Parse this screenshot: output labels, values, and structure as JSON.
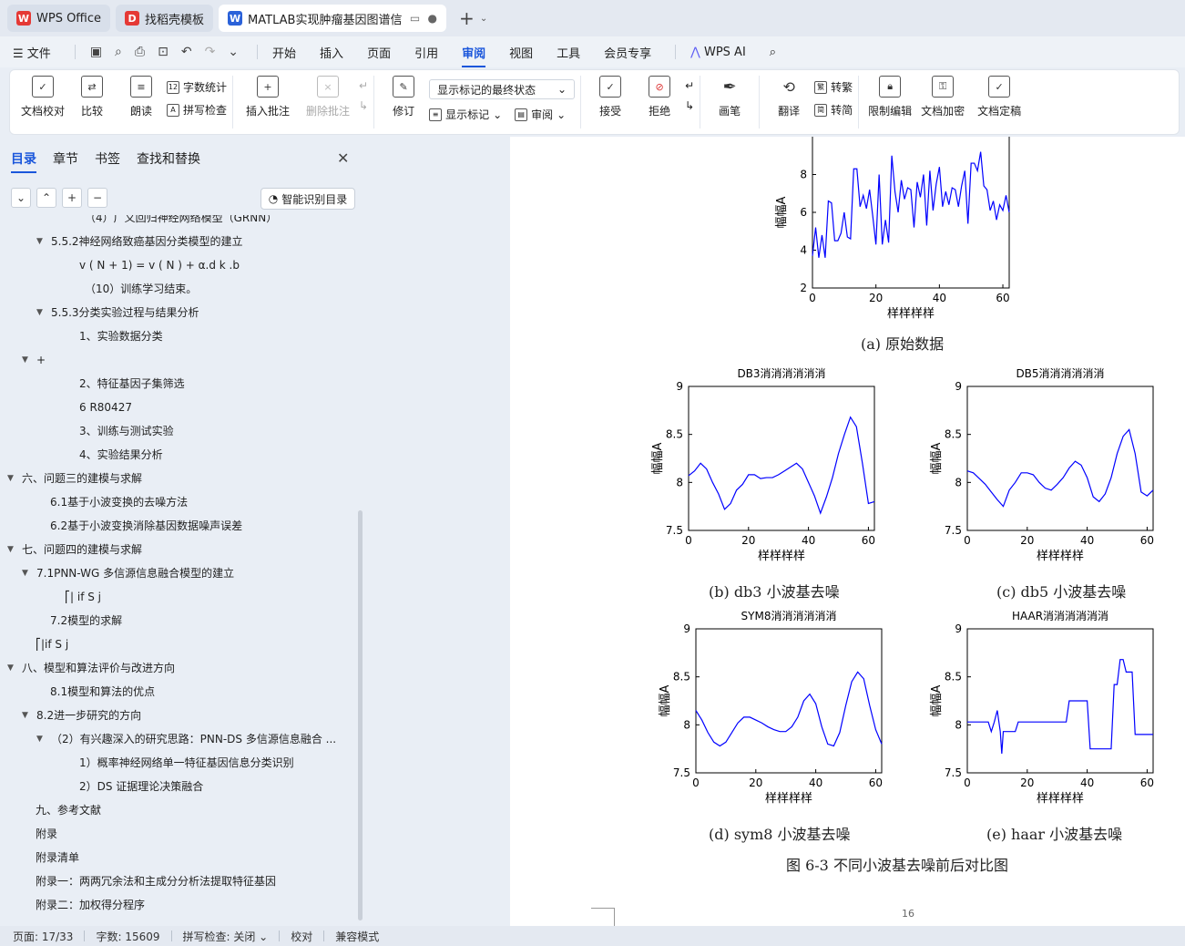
{
  "tabs": [
    {
      "label": "WPS Office",
      "icon": "wps-logo-icon"
    },
    {
      "label": "找稻壳模板",
      "icon": "docer-icon"
    },
    {
      "label": "MATLAB实现肿瘤基因图谱信",
      "icon": "word-doc-icon",
      "active": true
    }
  ],
  "menubar": {
    "file": "文件",
    "items": [
      "开始",
      "插入",
      "页面",
      "引用",
      "审阅",
      "视图",
      "工具",
      "会员专享"
    ],
    "active": "审阅",
    "ai": "WPS AI"
  },
  "ribbon": {
    "doc_check": "文档校对",
    "compare": "比较",
    "read_aloud": "朗读",
    "word_count": "字数统计",
    "spell_check": "拼写检查",
    "insert_comment": "插入批注",
    "delete_comment": "删除批注",
    "track": "修订",
    "markup_select": "显示标记的最终状态",
    "show_markup": "显示标记",
    "review": "审阅",
    "accept": "接受",
    "reject": "拒绝",
    "pen": "画笔",
    "translate": "翻译",
    "to_traditional": "转繁",
    "to_simplified": "转简",
    "restrict": "限制编辑",
    "encrypt": "文档加密",
    "finalize": "文档定稿"
  },
  "nav": {
    "tabs": [
      "目录",
      "章节",
      "书签",
      "查找和替换"
    ],
    "active_tab": "目录",
    "smart_btn": "智能识别目录",
    "items": [
      {
        "text": "（4）广义回归神经网络模型（GRNN）",
        "indent": 93,
        "tri": ""
      },
      {
        "text": "5.5.2神经网络致癌基因分类模型的建立",
        "indent": 56,
        "tri": "▼"
      },
      {
        "text": "v ( N + 1) = v ( N ) + α.d k .b",
        "indent": 87,
        "tri": ""
      },
      {
        "text": "（10）训练学习结束。",
        "indent": 93,
        "tri": ""
      },
      {
        "text": "5.5.3分类实验过程与结果分析",
        "indent": 56,
        "tri": "▼"
      },
      {
        "text": "1、实验数据分类",
        "indent": 87,
        "tri": ""
      },
      {
        "text": "+",
        "indent": 40,
        "tri": "▼"
      },
      {
        "text": "2、特征基因子集筛选",
        "indent": 87,
        "tri": ""
      },
      {
        "text": "6 R80427",
        "indent": 87,
        "tri": ""
      },
      {
        "text": "3、训练与测试实验",
        "indent": 87,
        "tri": ""
      },
      {
        "text": "4、实验结果分析",
        "indent": 87,
        "tri": ""
      },
      {
        "text": "六、问题三的建模与求解",
        "indent": 24,
        "tri": "▼"
      },
      {
        "text": "6.1基于小波变换的去噪方法",
        "indent": 55,
        "tri": ""
      },
      {
        "text": "6.2基于小波变换消除基因数据噪声误差",
        "indent": 55,
        "tri": ""
      },
      {
        "text": "七、问题四的建模与求解",
        "indent": 24,
        "tri": "▼"
      },
      {
        "text": "7.1PNN-WG 多信源信息融合模型的建立",
        "indent": 40,
        "tri": "▼"
      },
      {
        "text": "⎡| if  S j",
        "indent": 71,
        "tri": ""
      },
      {
        "text": "7.2模型的求解",
        "indent": 55,
        "tri": ""
      },
      {
        "text": "⎡|if  S j",
        "indent": 39,
        "tri": ""
      },
      {
        "text": "八、模型和算法评价与改进方向",
        "indent": 24,
        "tri": "▼"
      },
      {
        "text": "8.1模型和算法的优点",
        "indent": 55,
        "tri": ""
      },
      {
        "text": "8.2进一步研究的方向",
        "indent": 40,
        "tri": "▼"
      },
      {
        "text": "（2）有兴趣深入的研究思路：PNN-DS 多信源信息融合 ...",
        "indent": 56,
        "tri": "▼"
      },
      {
        "text": "1）概率神经网络单一特征基因信息分类识别",
        "indent": 87,
        "tri": ""
      },
      {
        "text": "2）DS 证据理论决策融合",
        "indent": 87,
        "tri": ""
      },
      {
        "text": "九、参考文献",
        "indent": 39,
        "tri": ""
      },
      {
        "text": "附录",
        "indent": 39,
        "tri": ""
      },
      {
        "text": "附录清单",
        "indent": 39,
        "tri": ""
      },
      {
        "text": "附录一：两两冗余法和主成分分析法提取特征基因",
        "indent": 39,
        "tri": ""
      },
      {
        "text": "附录二：加权得分程序",
        "indent": 39,
        "tri": ""
      }
    ]
  },
  "document": {
    "captions": {
      "a": "(a) 原始数据",
      "b": "(b) db3  小波基去噪",
      "c": "(c) db5 小波基去噪",
      "d": "(d) sym8 小波基去噪",
      "e": "(e) haar 小波基去噪",
      "figure": "图 6-3  不同小波基去噪前后对比图"
    },
    "page_number": "16"
  },
  "chart_data": [
    {
      "type": "line",
      "title": "",
      "xlabel": "样样样样",
      "ylabel": "幅幅A",
      "xlim": [
        0,
        62
      ],
      "ylim": [
        2,
        10
      ],
      "xticks": [
        0,
        20,
        40,
        60
      ],
      "yticks": [
        2,
        4,
        6,
        8
      ],
      "x": [
        0,
        1,
        2,
        3,
        4,
        5,
        6,
        7,
        8,
        9,
        10,
        11,
        12,
        13,
        14,
        15,
        16,
        17,
        18,
        19,
        20,
        21,
        22,
        23,
        24,
        25,
        26,
        27,
        28,
        29,
        30,
        31,
        32,
        33,
        34,
        35,
        36,
        37,
        38,
        39,
        40,
        41,
        42,
        43,
        44,
        45,
        46,
        47,
        48,
        49,
        50,
        51,
        52,
        53,
        54,
        55,
        56,
        57,
        58,
        59,
        60,
        61,
        62
      ],
      "series": [
        {
          "values": [
            3.7,
            5.2,
            3.6,
            4.8,
            3.6,
            6.6,
            6.5,
            4.5,
            4.5,
            4.9,
            6.0,
            4.7,
            4.6,
            8.3,
            8.3,
            6.3,
            6.9,
            6.2,
            7.2,
            5.8,
            4.3,
            8.0,
            4.3,
            5.6,
            4.4,
            9.0,
            7.1,
            6.0,
            7.7,
            6.7,
            7.3,
            7.2,
            5.2,
            7.6,
            6.8,
            8.0,
            5.3,
            8.2,
            6.1,
            7.5,
            8.4,
            6.3,
            7.1,
            6.4,
            7.3,
            7.2,
            6.3,
            7.4,
            8.2,
            5.4,
            8.6,
            8.6,
            8.2,
            9.2,
            7.4,
            7.2,
            6.1,
            6.6,
            5.6,
            6.4,
            6.1,
            6.9,
            6.0
          ]
        }
      ]
    },
    {
      "type": "line",
      "title": "DB3消消消消消消",
      "xlabel": "样样样样",
      "ylabel": "幅幅A",
      "xlim": [
        0,
        62
      ],
      "ylim": [
        7.5,
        9
      ],
      "xticks": [
        0,
        20,
        40,
        60
      ],
      "yticks": [
        7.5,
        8,
        8.5,
        9
      ],
      "x": [
        0,
        2,
        4,
        6,
        8,
        10,
        12,
        14,
        16,
        18,
        20,
        22,
        24,
        26,
        28,
        30,
        32,
        34,
        36,
        38,
        40,
        42,
        44,
        46,
        48,
        50,
        52,
        54,
        56,
        58,
        60,
        62
      ],
      "series": [
        {
          "values": [
            8.07,
            8.12,
            8.2,
            8.14,
            8.0,
            7.88,
            7.72,
            7.78,
            7.92,
            7.98,
            8.08,
            8.08,
            8.04,
            8.05,
            8.05,
            8.08,
            8.12,
            8.16,
            8.2,
            8.14,
            8.0,
            7.86,
            7.68,
            7.85,
            8.05,
            8.3,
            8.5,
            8.68,
            8.58,
            8.2,
            7.78,
            7.8
          ]
        }
      ]
    },
    {
      "type": "line",
      "title": "DB5消消消消消消",
      "xlabel": "样样样样",
      "ylabel": "幅幅A",
      "xlim": [
        0,
        62
      ],
      "ylim": [
        7.5,
        9
      ],
      "xticks": [
        0,
        20,
        40,
        60
      ],
      "yticks": [
        7.5,
        8,
        8.5,
        9
      ],
      "x": [
        0,
        2,
        4,
        6,
        8,
        10,
        12,
        14,
        16,
        18,
        20,
        22,
        24,
        26,
        28,
        30,
        32,
        34,
        36,
        38,
        40,
        42,
        44,
        46,
        48,
        50,
        52,
        54,
        56,
        58,
        60,
        62
      ],
      "series": [
        {
          "values": [
            8.12,
            8.1,
            8.04,
            7.98,
            7.9,
            7.82,
            7.75,
            7.92,
            8.0,
            8.1,
            8.1,
            8.08,
            8.0,
            7.94,
            7.92,
            7.98,
            8.05,
            8.15,
            8.22,
            8.18,
            8.05,
            7.85,
            7.8,
            7.88,
            8.05,
            8.3,
            8.48,
            8.55,
            8.3,
            7.9,
            7.86,
            7.92
          ]
        }
      ]
    },
    {
      "type": "line",
      "title": "SYM8消消消消消消",
      "xlabel": "样样样样",
      "ylabel": "幅幅A",
      "xlim": [
        0,
        62
      ],
      "ylim": [
        7.5,
        9
      ],
      "xticks": [
        0,
        20,
        40,
        60
      ],
      "yticks": [
        7.5,
        8,
        8.5,
        9
      ],
      "x": [
        0,
        2,
        4,
        6,
        8,
        10,
        12,
        14,
        16,
        18,
        20,
        22,
        24,
        26,
        28,
        30,
        32,
        34,
        36,
        38,
        40,
        42,
        44,
        46,
        48,
        50,
        52,
        54,
        56,
        58,
        60,
        62
      ],
      "series": [
        {
          "values": [
            8.15,
            8.05,
            7.92,
            7.82,
            7.78,
            7.82,
            7.92,
            8.02,
            8.08,
            8.08,
            8.05,
            8.02,
            7.98,
            7.95,
            7.93,
            7.93,
            7.98,
            8.08,
            8.25,
            8.32,
            8.22,
            7.98,
            7.8,
            7.78,
            7.92,
            8.2,
            8.45,
            8.55,
            8.48,
            8.2,
            7.95,
            7.8
          ]
        }
      ]
    },
    {
      "type": "line",
      "title": "HAAR消消消消消消",
      "xlabel": "样样样样",
      "ylabel": "幅幅A",
      "xlim": [
        0,
        62
      ],
      "ylim": [
        7.5,
        9
      ],
      "xticks": [
        0,
        20,
        40,
        60
      ],
      "yticks": [
        7.5,
        8,
        8.5,
        9
      ],
      "x": [
        0,
        7,
        8,
        9,
        10,
        11,
        11.5,
        12,
        13,
        16,
        17,
        33,
        34,
        40,
        41,
        48,
        49,
        50,
        51,
        52,
        53,
        55,
        56,
        57,
        62
      ],
      "series": [
        {
          "values": [
            8.03,
            8.03,
            7.93,
            8.03,
            8.15,
            7.93,
            7.7,
            7.93,
            7.93,
            7.93,
            8.03,
            8.03,
            8.25,
            8.25,
            7.75,
            7.75,
            8.42,
            8.42,
            8.68,
            8.68,
            8.55,
            8.55,
            7.9,
            7.9,
            7.9
          ]
        }
      ]
    }
  ],
  "statusbar": {
    "page": "页面: 17/33",
    "words": "字数: 15609",
    "spell": "拼写检查: 关闭",
    "proof": "校对",
    "compat": "兼容模式"
  }
}
